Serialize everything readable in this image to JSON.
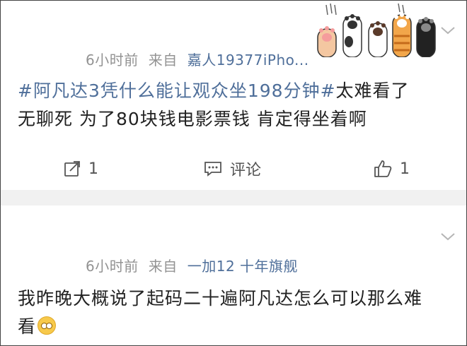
{
  "posts": [
    {
      "time": "6小时前",
      "from_label": "来自",
      "source": "嘉人19377iPho...",
      "hashtag": "#阿凡达3凭什么能让观众坐198分钟#",
      "text_after_hashtag": "太难看了",
      "line2": "无聊死  为了80块钱电影票钱  肯定得坐着啊",
      "actions": {
        "share_count": "1",
        "comment_label": "评论",
        "like_count": "1"
      }
    },
    {
      "time": "6小时前",
      "from_label": "来自",
      "source": "一加12 十年旗舰",
      "line1": "我昨晚大概说了起码二十遍阿凡达怎么可以那么难",
      "line2": "看"
    }
  ],
  "icons": {
    "chevron": "chevron-down-icon",
    "share": "share-icon",
    "comment": "comment-icon",
    "like": "thumbs-up-icon",
    "paws": "cat-paws-decoration",
    "emoji": "flushed-face-emoji"
  },
  "colors": {
    "link": "#4f6f9a",
    "meta": "#939393",
    "text": "#222222",
    "separator": "#f1f1f1"
  }
}
